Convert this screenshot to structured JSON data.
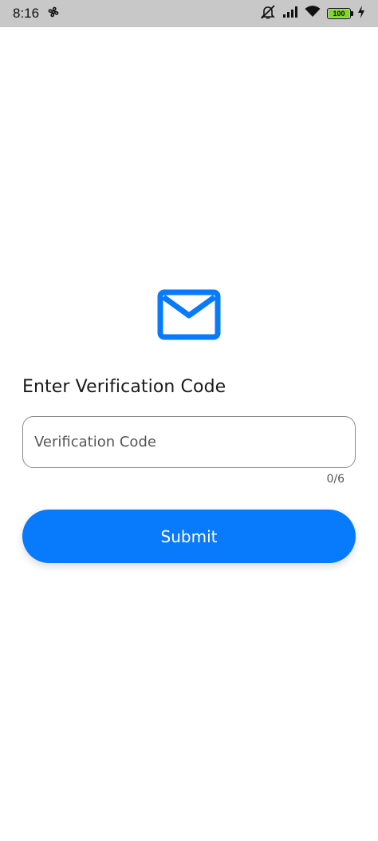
{
  "status_bar": {
    "time": "8:16",
    "battery_level": "100",
    "battery_fraction": 1.0,
    "icons": [
      "fan-icon",
      "mute-icon",
      "signal-icon",
      "wifi-icon",
      "battery-icon",
      "charging-icon"
    ]
  },
  "main": {
    "icon": "mail-icon",
    "heading": "Enter Verification Code",
    "input": {
      "placeholder": "Verification Code",
      "value": ""
    },
    "counter": "0/6",
    "submit_label": "Submit"
  },
  "colors": {
    "accent": "#077bfb",
    "status_bar_bg": "#c8c8c8",
    "battery_green": "#7cd82b"
  }
}
